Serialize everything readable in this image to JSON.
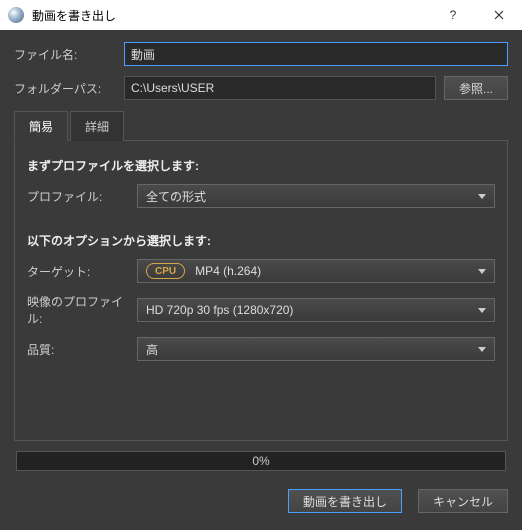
{
  "window": {
    "title": "動画を書き出し"
  },
  "fields": {
    "filename_label": "ファイル名:",
    "filename_value": "動画",
    "folder_label": "フォルダーパス:",
    "folder_value": "C:\\Users\\USER",
    "browse": "参照..."
  },
  "tabs": {
    "simple": "簡易",
    "detail": "詳細"
  },
  "section1": {
    "heading": "まずプロファイルを選択します:",
    "profile_label": "プロファイル:",
    "profile_value": "全ての形式"
  },
  "section2": {
    "heading": "以下のオプションから選択します:",
    "target_label": "ターゲット:",
    "target_badge": "CPU",
    "target_value": "MP4 (h.264)",
    "vprofile_label": "映像のプロファイル:",
    "vprofile_value": "HD 720p 30 fps (1280x720)",
    "quality_label": "品質:",
    "quality_value": "高"
  },
  "progress": {
    "text": "0%"
  },
  "footer": {
    "export": "動画を書き出し",
    "cancel": "キャンセル"
  }
}
